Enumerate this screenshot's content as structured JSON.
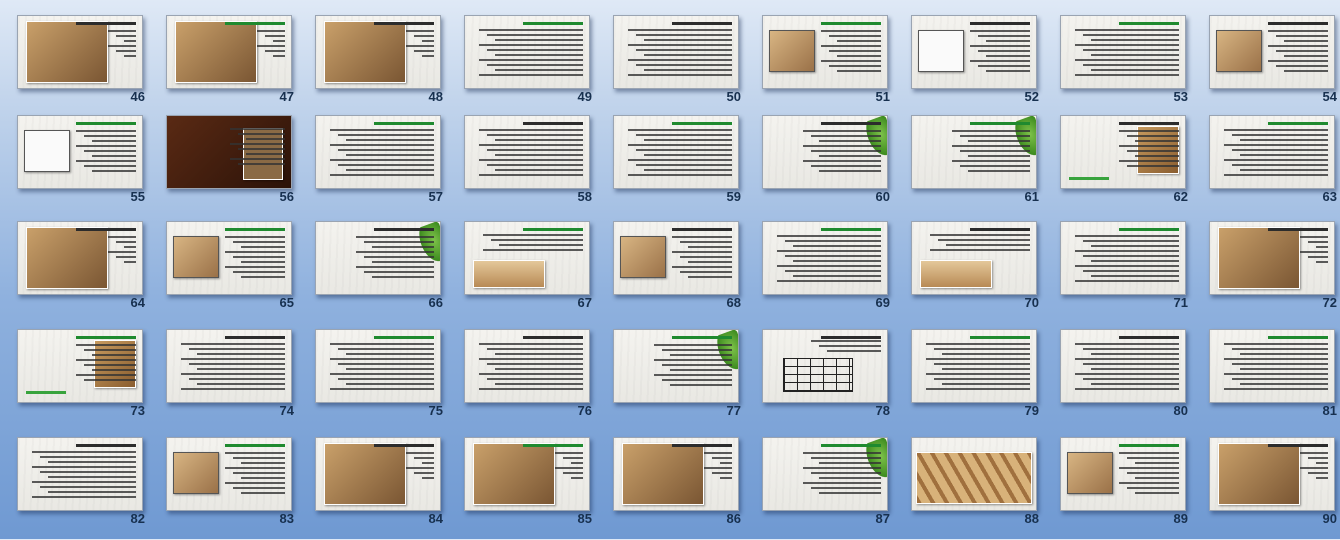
{
  "slides": [
    {
      "number": "46",
      "kind": "photo-left"
    },
    {
      "number": "47",
      "kind": "photo-left"
    },
    {
      "number": "48",
      "kind": "photo-left"
    },
    {
      "number": "49",
      "kind": "text"
    },
    {
      "number": "50",
      "kind": "text"
    },
    {
      "number": "51",
      "kind": "photo-left-small"
    },
    {
      "number": "52",
      "kind": "diagram-left"
    },
    {
      "number": "53",
      "kind": "text"
    },
    {
      "number": "54",
      "kind": "photo-left-small"
    },
    {
      "number": "55",
      "kind": "diagram-left"
    },
    {
      "number": "56",
      "kind": "dark"
    },
    {
      "number": "57",
      "kind": "text"
    },
    {
      "number": "58",
      "kind": "text"
    },
    {
      "number": "59",
      "kind": "text"
    },
    {
      "number": "60",
      "kind": "leaf"
    },
    {
      "number": "61",
      "kind": "leaf"
    },
    {
      "number": "62",
      "kind": "photo-right"
    },
    {
      "number": "63",
      "kind": "text"
    },
    {
      "number": "64",
      "kind": "photo-left"
    },
    {
      "number": "65",
      "kind": "photo-left-small"
    },
    {
      "number": "66",
      "kind": "leaf"
    },
    {
      "number": "67",
      "kind": "photo-wide"
    },
    {
      "number": "68",
      "kind": "photo-left-small"
    },
    {
      "number": "69",
      "kind": "text"
    },
    {
      "number": "70",
      "kind": "photo-wide"
    },
    {
      "number": "71",
      "kind": "text"
    },
    {
      "number": "72",
      "kind": "photo-left"
    },
    {
      "number": "73",
      "kind": "photo-right"
    },
    {
      "number": "74",
      "kind": "text"
    },
    {
      "number": "75",
      "kind": "text"
    },
    {
      "number": "76",
      "kind": "text"
    },
    {
      "number": "77",
      "kind": "leaf"
    },
    {
      "number": "78",
      "kind": "table"
    },
    {
      "number": "79",
      "kind": "text"
    },
    {
      "number": "80",
      "kind": "text"
    },
    {
      "number": "81",
      "kind": "text"
    },
    {
      "number": "82",
      "kind": "text"
    },
    {
      "number": "83",
      "kind": "photo-left-small"
    },
    {
      "number": "84",
      "kind": "photo-left"
    },
    {
      "number": "85",
      "kind": "photo-left"
    },
    {
      "number": "86",
      "kind": "photo-left"
    },
    {
      "number": "87",
      "kind": "leaf"
    },
    {
      "number": "88",
      "kind": "photo-full"
    },
    {
      "number": "89",
      "kind": "photo-left-small"
    },
    {
      "number": "90",
      "kind": "photo-left"
    }
  ]
}
